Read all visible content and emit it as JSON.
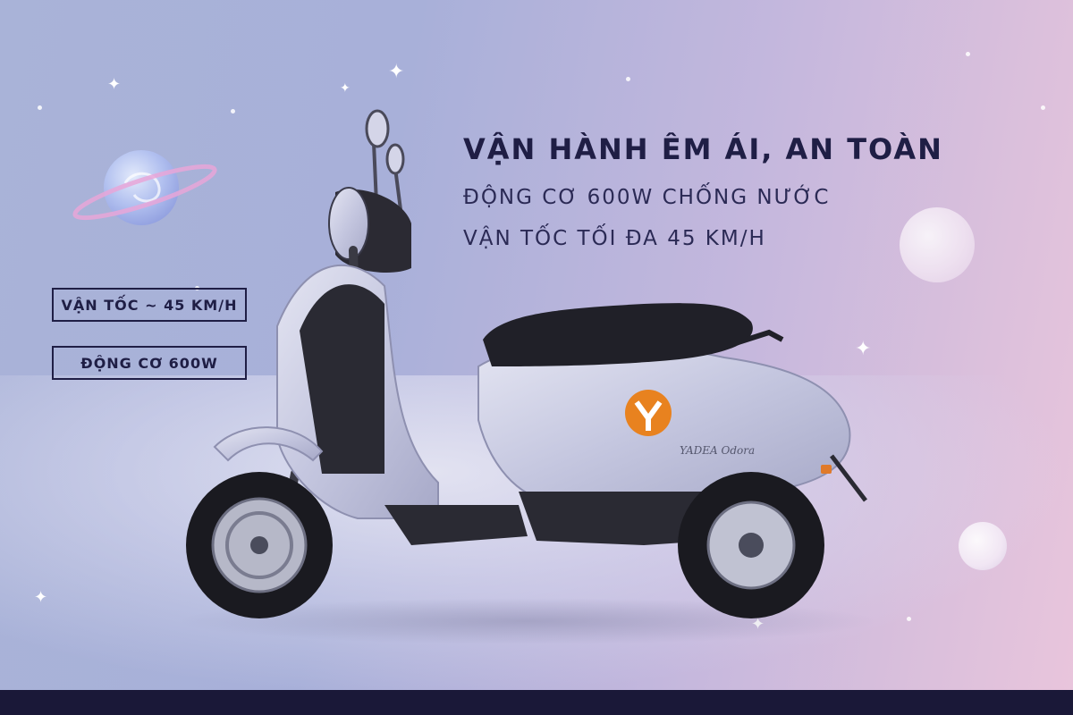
{
  "headline": "VẬN HÀNH ÊM ÁI, AN TOÀN",
  "subline_1": "ĐỘNG CƠ 600W CHỐNG NƯỚC",
  "subline_2": "VẬN TỐC TỐI ĐA 45 KM/H",
  "badges": {
    "speed": "VẬN TỐC ~ 45 KM/H",
    "motor": "ĐỘNG CƠ 600W"
  },
  "product": {
    "logo_text": "YADEA Odora"
  },
  "colors": {
    "text_dark": "#1f1e45",
    "logo_orange": "#e8821f",
    "scooter_body": "#c9cbe0",
    "bottom_bar": "#1a1838"
  },
  "icons": [
    "sparkle-icon",
    "planet-icon",
    "moon-icon",
    "yadea-logo-icon"
  ]
}
